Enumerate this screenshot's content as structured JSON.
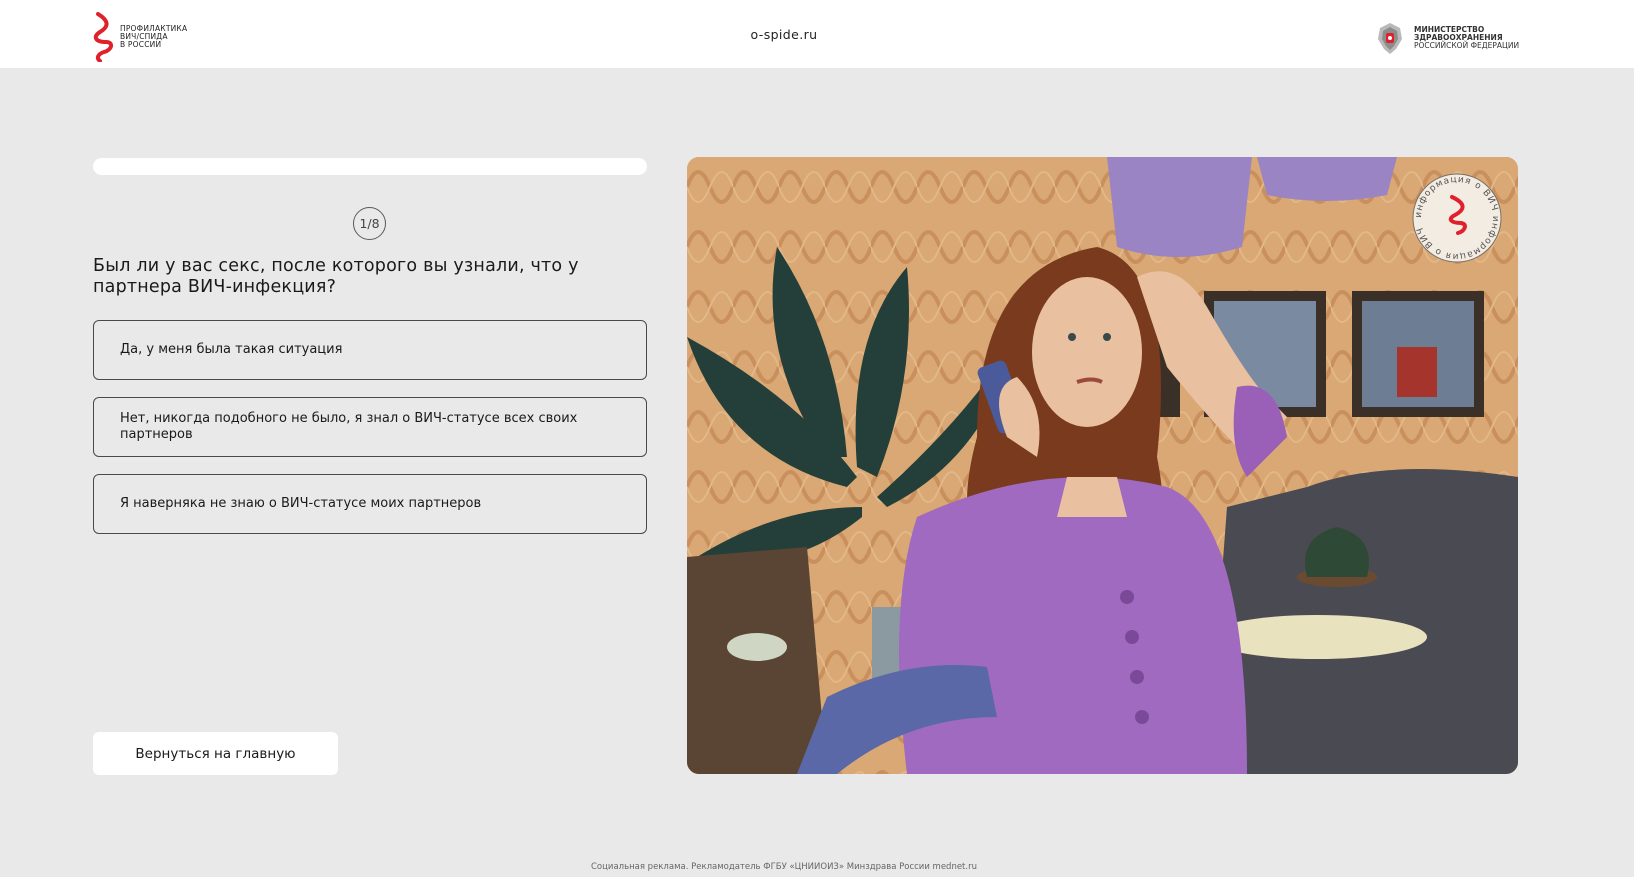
{
  "header": {
    "logo_left_text": [
      "ПРОФИЛАКТИКА",
      "ВИЧ/СПИДа",
      "В РОССИИ"
    ],
    "site_url": "o-spide.ru",
    "ministry_lines": [
      "МИНИСТЕРСТВО",
      "ЗДРАВООХРАНЕНИЯ",
      "РОССИЙСКОЙ ФЕДЕРАЦИИ"
    ]
  },
  "quiz": {
    "progress": 0.0,
    "step_label": "1/8",
    "question": "Был ли у вас секс, после которого вы узнали, что у партнера ВИЧ-инфекция?",
    "options": [
      "Да, у меня была такая ситуация",
      "Нет, никогда подобного не было, я знал о ВИЧ-статусе всех своих партнеров",
      "Я наверняка не знаю о ВИЧ-статусе моих партнеров"
    ],
    "back_label": "Вернуться на главную"
  },
  "illustration": {
    "stamp_text": "информация о ВИЧ информация о ВИЧ"
  },
  "footer": {
    "note": "Социальная реклама. Рекламодатель ФГБУ «ЦНИИОИЗ» Минздрава России mednet.ru"
  },
  "colors": {
    "accent_red": "#e0202a",
    "background": "#e9e9e9",
    "wallpaper": "#d9a874",
    "blouse": "#a06ac0"
  }
}
